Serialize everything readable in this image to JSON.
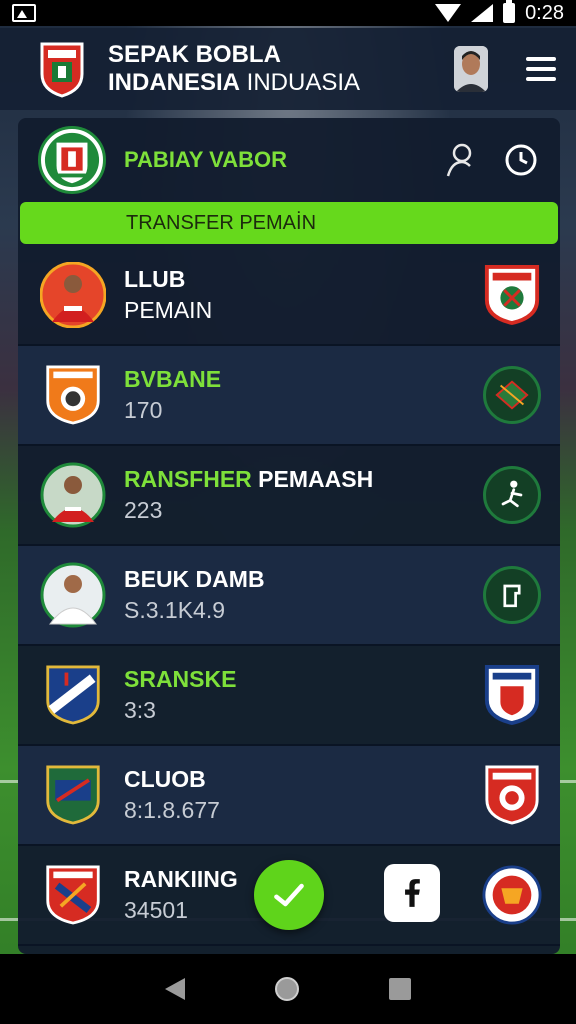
{
  "status_bar": {
    "time": "0:28"
  },
  "header": {
    "title_line1": "SEPAK BOBLA",
    "title_line2_bold": "INDANESIA",
    "title_line2_rest": " INDUASIA"
  },
  "card": {
    "club_name": "PABIAY VABOR",
    "banner_label": "TRANSFER PEMAİN"
  },
  "rows": [
    {
      "title": "LLUB",
      "subtitle": "PEMAIN"
    },
    {
      "title": "BVBANE",
      "subtitle": "170"
    },
    {
      "title": "RANSFHER",
      "title_rest": " PEMAASH",
      "subtitle": "223"
    },
    {
      "title": "BEUK DAMB",
      "subtitle": "S.3.1K4.9"
    },
    {
      "title": "SRANSKE",
      "subtitle": "3:3"
    },
    {
      "title": "CLUOB",
      "subtitle": "8:1.8.677"
    },
    {
      "title": "RANKIING",
      "subtitle": "34501"
    }
  ],
  "colors": {
    "accent_green": "#66d91c",
    "text_green": "#7ee03a",
    "card_bg": "#121c2e",
    "row_alt_bg": "#1b2a43"
  },
  "icons": {
    "header_crest": "club-crest-icon",
    "profile": "user-icon",
    "history": "clock-icon",
    "menu": "hamburger-menu-icon",
    "fab": "checkmark-icon",
    "facebook": "facebook-icon"
  }
}
